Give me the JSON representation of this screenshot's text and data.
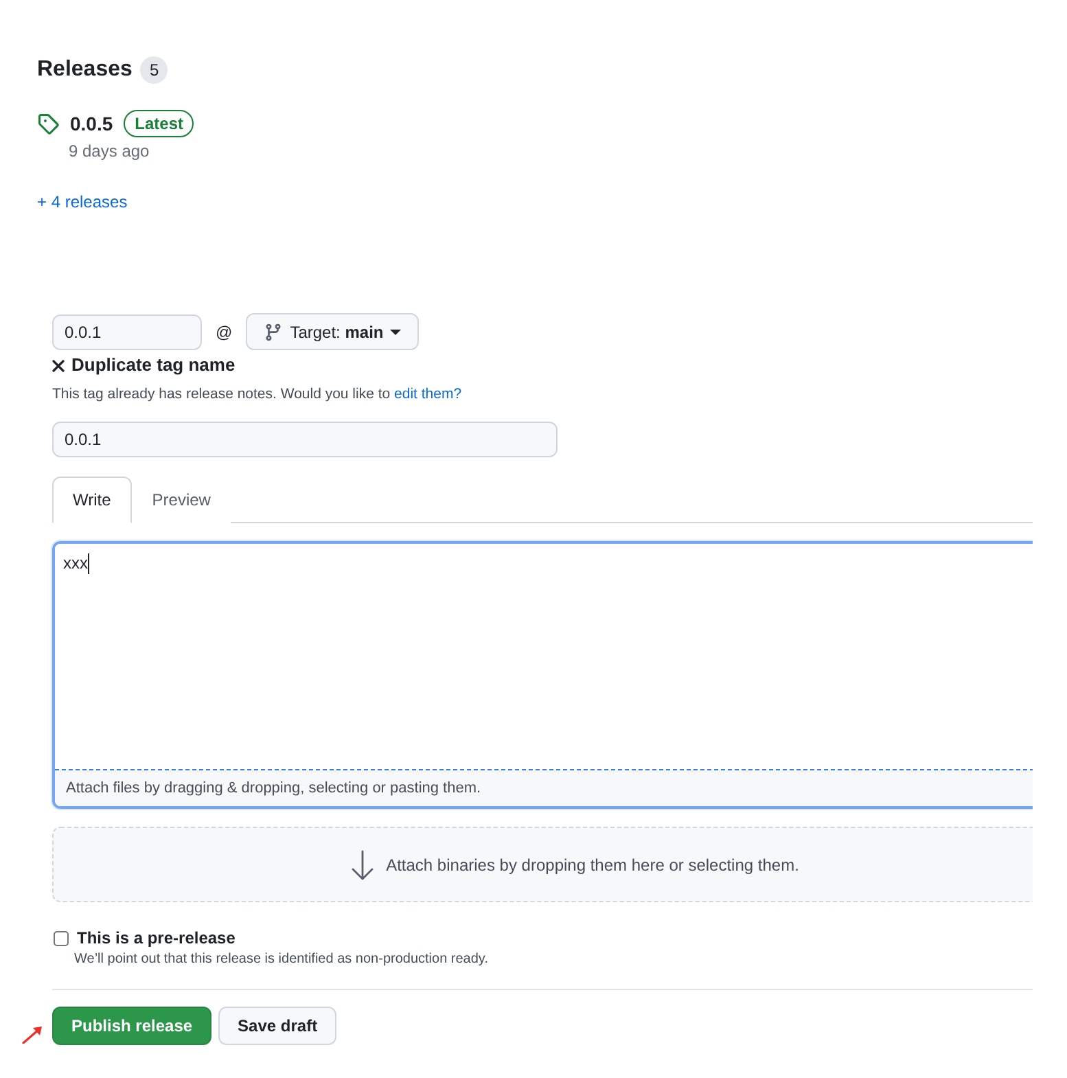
{
  "releases": {
    "title": "Releases",
    "count": "5",
    "latest": {
      "tag": "0.0.5",
      "badge": "Latest",
      "age": "9 days ago"
    },
    "more_link": "+ 4 releases"
  },
  "form": {
    "tag_field": {
      "value": "0.0.1"
    },
    "at_sign": "@",
    "target_button": {
      "label": "Target: **main**"
    },
    "error": {
      "title": "Duplicate tag name",
      "message": "This tag already has release notes. Would you like to",
      "link": "edit them?"
    },
    "title_field": {
      "value": "0.0.1"
    },
    "tabs": [
      {
        "label": "Write",
        "selected": true
      },
      {
        "label": "Preview",
        "selected": false
      }
    ],
    "editor": {
      "value": "xxx",
      "focused": true,
      "hint": "Attach files by dragging & dropping, selecting or pasting them."
    },
    "dropzone": {
      "text": "Attach binaries by dropping them here or selecting them."
    },
    "prerelease": {
      "label": "This is a pre-release",
      "checked": false,
      "note": "We’ll point out that this release is identified as non-production ready."
    },
    "buttons": [
      {
        "label": "Publish release",
        "kind": "primary"
      },
      {
        "label": "Save draft",
        "kind": "secondary"
      }
    ]
  }
}
